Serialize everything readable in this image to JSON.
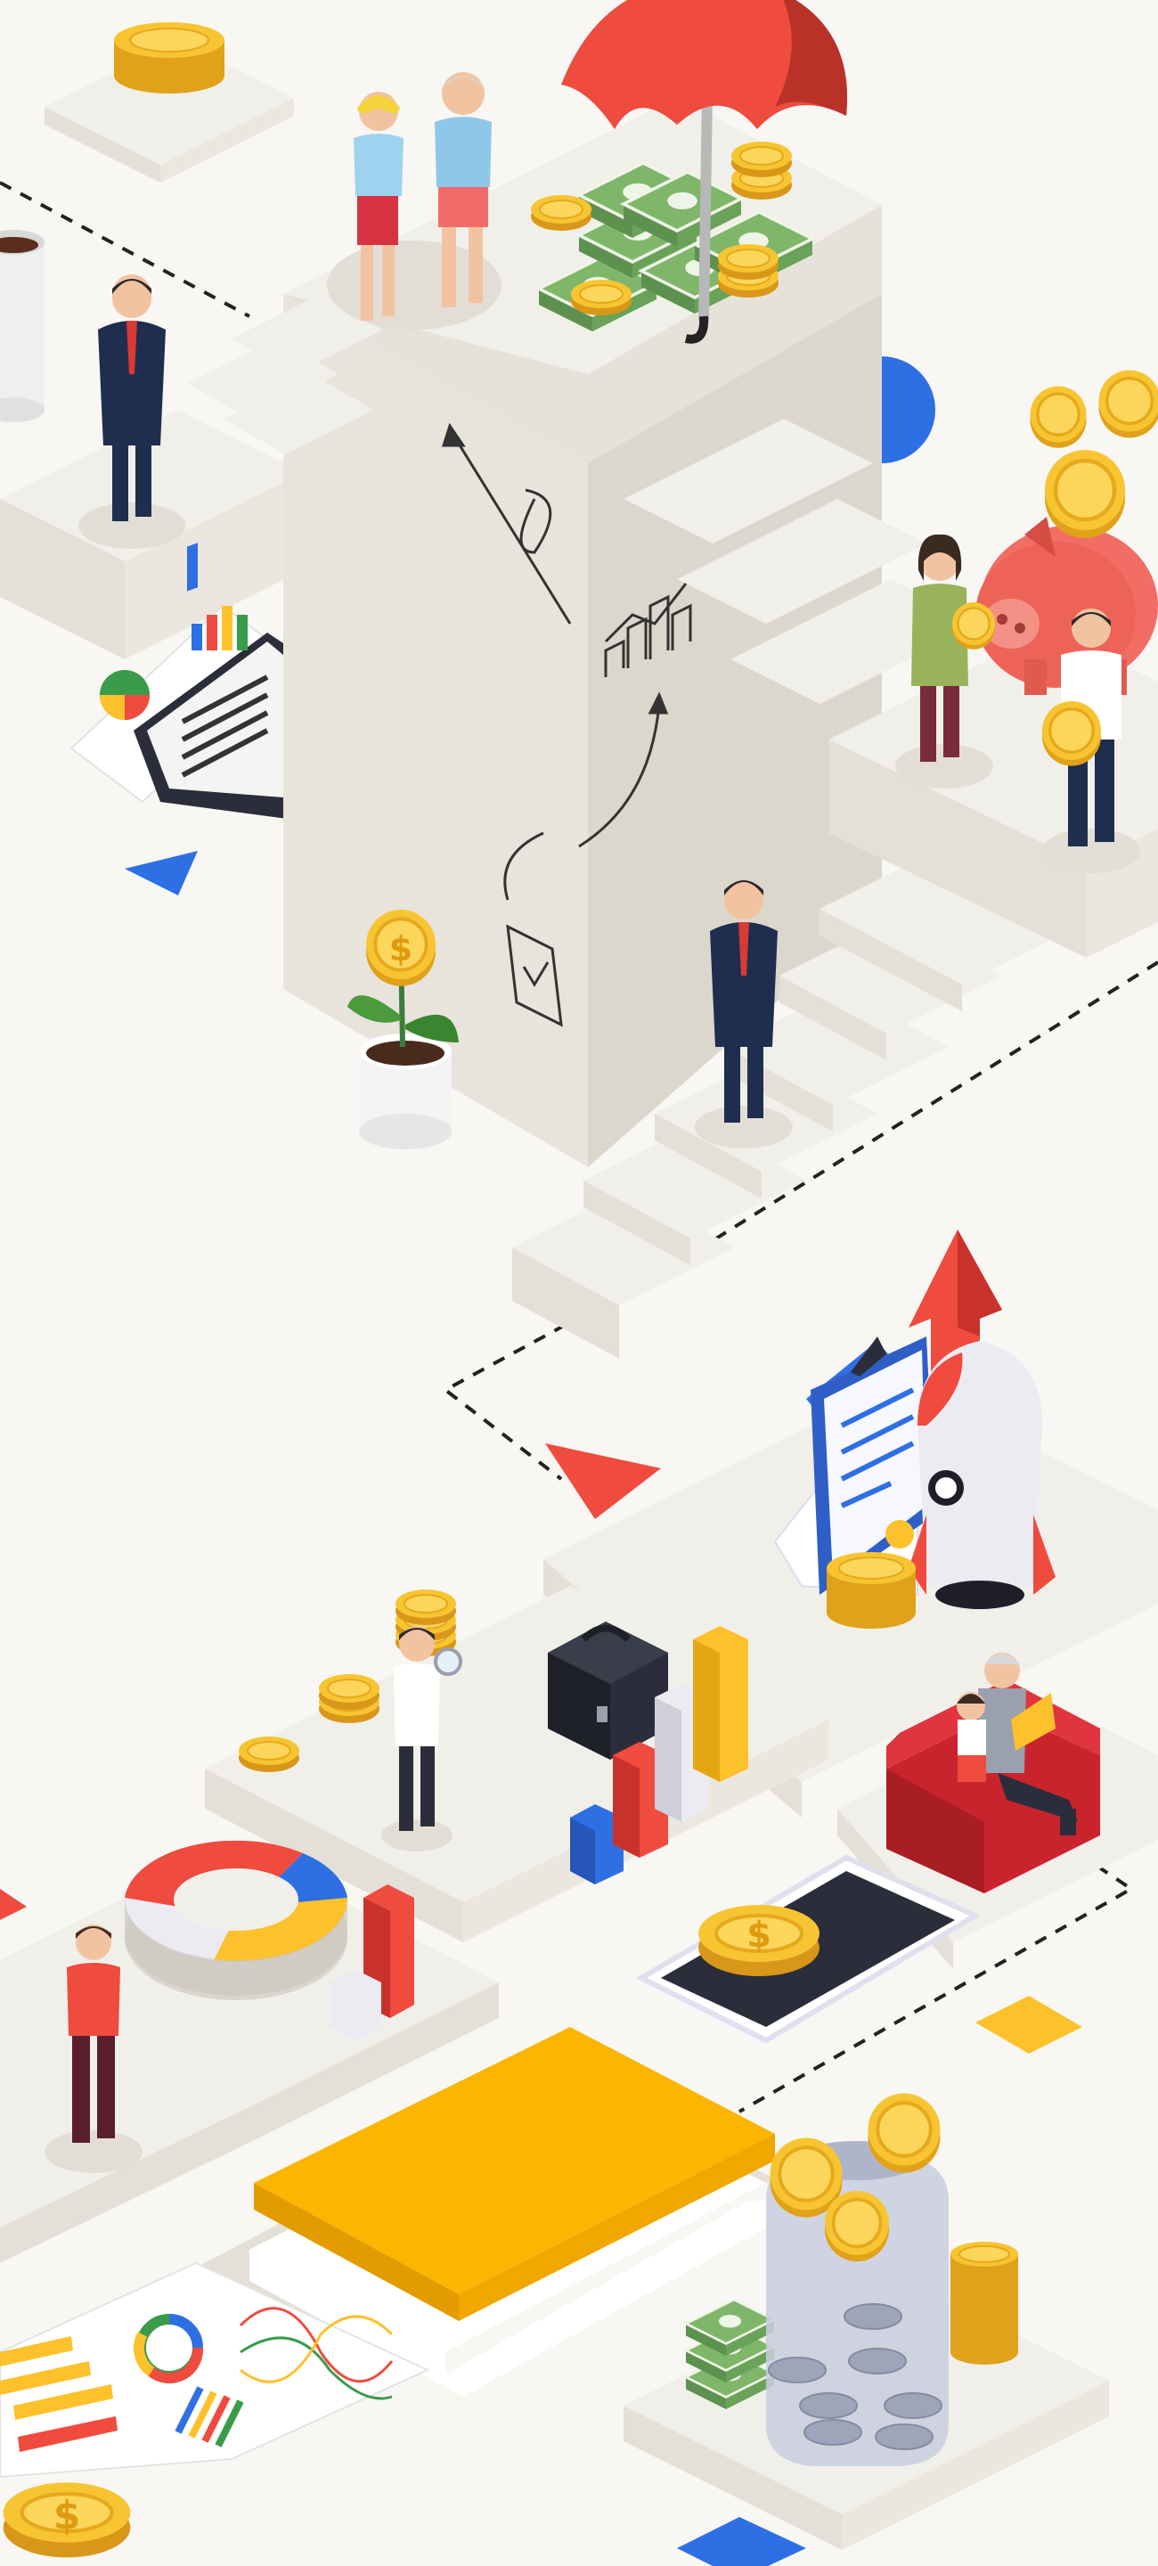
{
  "scene": {
    "colors": {
      "background": "#f8f7f4",
      "platform_top": "#f1efe9",
      "platform_side": "#e4e0d7",
      "tower_face": "#e6e2da",
      "tower_side": "#dcd7cd",
      "accent_red": "#ef4b3f",
      "accent_blue": "#2f6fe4",
      "accent_yellow": "#fcc12b",
      "coin_gold": "#f7c531",
      "suit_navy": "#1f2d4f",
      "cash_green": "#6aa25a"
    },
    "icons": [
      "umbrella-icon",
      "coin-stack-icon",
      "cash-bundle-icon",
      "piggy-bank-icon",
      "rocket-icon",
      "money-plant-icon",
      "coin-jar-icon",
      "donut-chart-icon",
      "bar-chart-icon",
      "briefcase-icon",
      "smartphone-icon",
      "sofa-icon",
      "clipboard-icon",
      "growth-chart-icon",
      "book-icon",
      "coffee-cup-icon"
    ],
    "coin_symbol": "$"
  }
}
